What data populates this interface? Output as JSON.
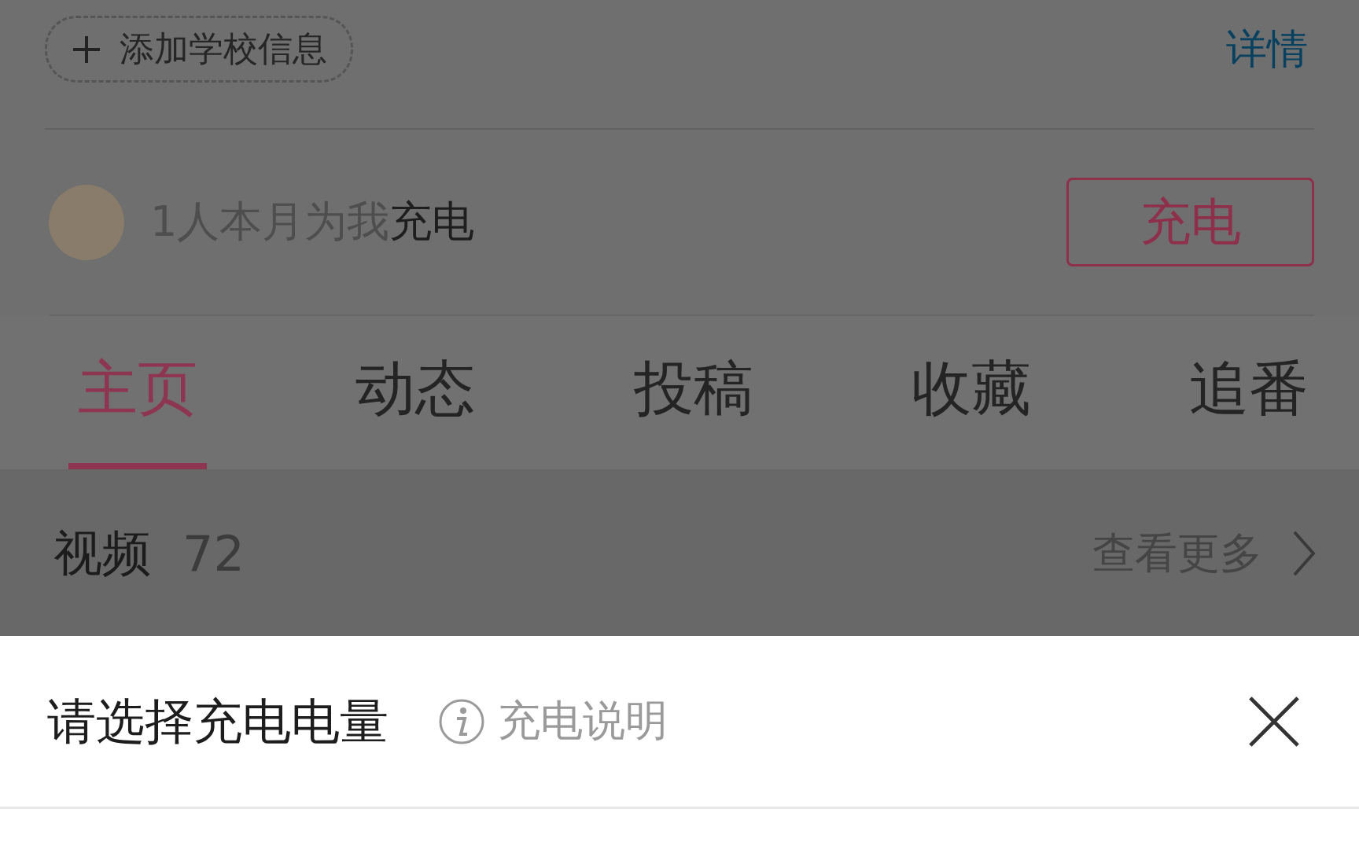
{
  "profile": {
    "school_button": "添加学校信息",
    "details_link": "详情"
  },
  "charge": {
    "text": "1人本月为我**充电**",
    "button": "充电"
  },
  "tabs": [
    {
      "label": "主页",
      "selected": true
    },
    {
      "label": "动态",
      "selected": false
    },
    {
      "label": "投稿",
      "selected": false
    },
    {
      "label": "收藏",
      "selected": false
    },
    {
      "label": "追番",
      "selected": false
    }
  ],
  "videos": {
    "title": "视频",
    "count": "72",
    "more": "查看更多"
  },
  "sheet": {
    "title": "请选择充电电量",
    "help": "充电说明"
  }
}
